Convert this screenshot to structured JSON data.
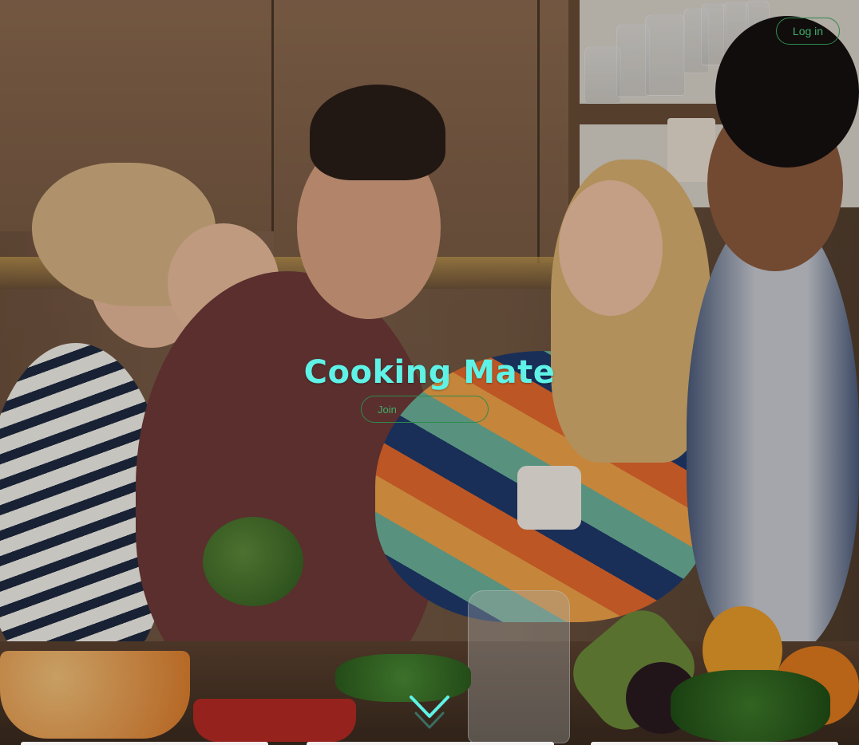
{
  "header": {
    "login_label": "Log in"
  },
  "hero": {
    "title": "Cooking Mate",
    "join_label": "Join",
    "scroll_icon": "chevron-down-icon"
  },
  "colors": {
    "title": "#5ff2e6",
    "button_border": "#2e8b4e",
    "button_text": "#3fae6a",
    "chevron": "#5ff2e6"
  }
}
